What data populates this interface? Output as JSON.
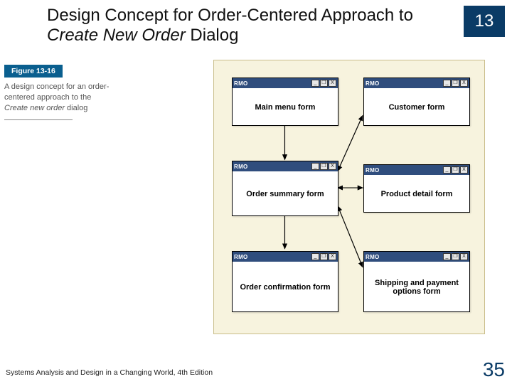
{
  "header": {
    "title_a": "Design Concept for Order-Centered Approach to ",
    "title_em": "Create New Order",
    "title_b": " Dialog",
    "chapter": "13"
  },
  "figure": {
    "label": "Figure 13-16",
    "caption_a": "A design concept for an order-centered approach to the ",
    "caption_em": "Create new order",
    "caption_b": " dialog"
  },
  "windows": {
    "brand": "RMO",
    "ctrl_min": "_",
    "ctrl_max": "❐",
    "ctrl_close": "X",
    "main_menu": "Main menu form",
    "customer": "Customer form",
    "order_summary": "Order summary form",
    "product_detail": "Product detail form",
    "order_confirm": "Order confirmation form",
    "shipping": "Shipping and payment options form"
  },
  "footer": {
    "left": "Systems Analysis and Design in a Changing World, 4th Edition",
    "page": "35"
  }
}
